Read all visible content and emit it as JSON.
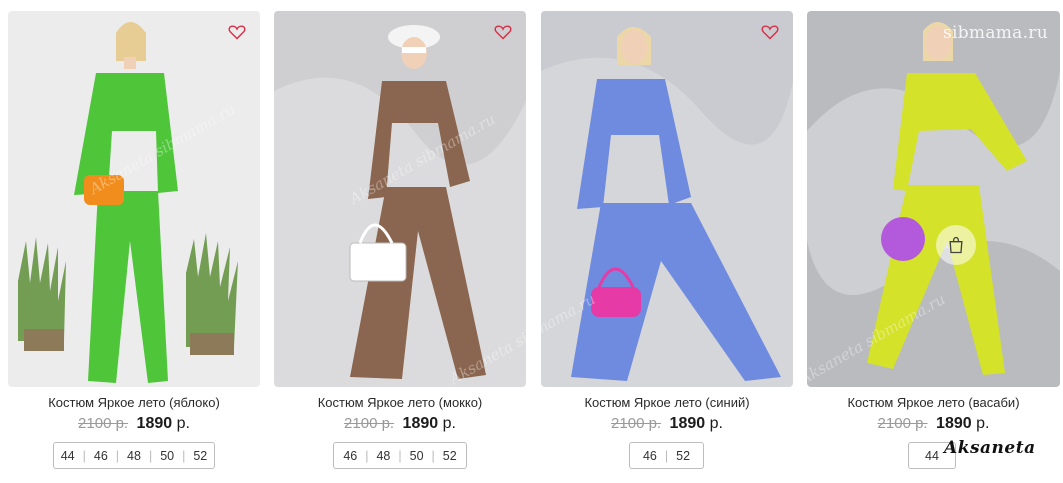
{
  "watermarks": {
    "site": "sibmama.ru",
    "brand": "Aksaneta",
    "diagonal": [
      "Aksaneta sibmama.ru",
      "Aksaneta sibmama.ru",
      "Aksaneta sibmama.ru",
      "Aksaneta sibmama.ru"
    ]
  },
  "products": [
    {
      "title": "Костюм Яркое лето (яблоко)",
      "old_price": "2100 р.",
      "new_price": "1890",
      "currency": "р.",
      "sizes": [
        "44",
        "46",
        "48",
        "50",
        "52"
      ],
      "suit_color": "#4fc63a",
      "bg_color": "#ececec",
      "favorite_icon": "heart-outline-icon",
      "favorite_color": "#d9304a"
    },
    {
      "title": "Костюм Яркое лето (мокко)",
      "old_price": "2100 р.",
      "new_price": "1890",
      "currency": "р.",
      "sizes": [
        "46",
        "48",
        "50",
        "52"
      ],
      "suit_color": "#8a6650",
      "bg_color": "#cfcfd2",
      "favorite_icon": "heart-outline-icon",
      "favorite_color": "#d9304a"
    },
    {
      "title": "Костюм Яркое лето (синий)",
      "old_price": "2100 р.",
      "new_price": "1890",
      "currency": "р.",
      "sizes": [
        "46",
        "52"
      ],
      "suit_color": "#6f8be0",
      "bg_color": "#c9cbd0",
      "favorite_icon": "heart-outline-icon",
      "favorite_color": "#d9304a"
    },
    {
      "title": "Костюм Яркое лето (васаби)",
      "old_price": "2100 р.",
      "new_price": "1890",
      "currency": "р.",
      "sizes": [
        "44"
      ],
      "suit_color": "#d4e22a",
      "bg_color": "#b9bbbf",
      "favorite_icon": "heart-outline-icon",
      "favorite_color": "#d9304a",
      "quick_view_icon": "shopping-bag-icon"
    }
  ]
}
